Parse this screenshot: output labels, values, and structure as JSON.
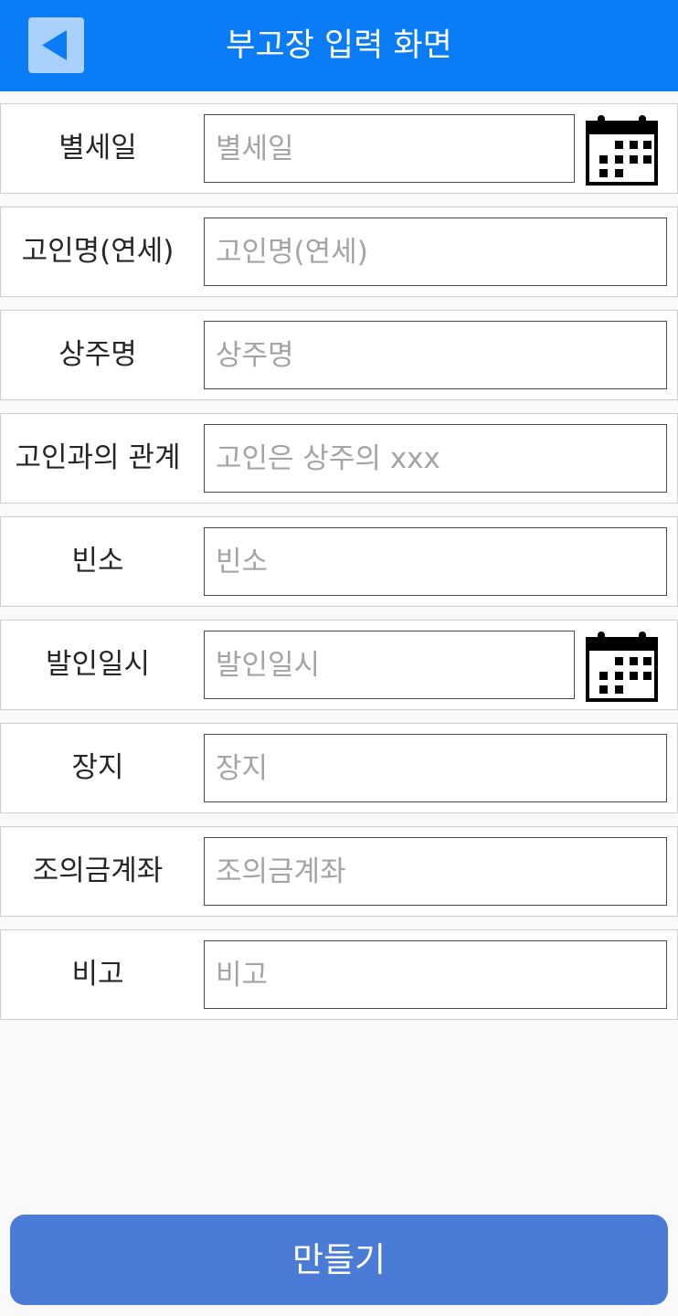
{
  "header": {
    "title": "부고장 입력 화면",
    "back_icon": "back-arrow-icon"
  },
  "colors": {
    "header_bg": "#0a7cf6",
    "back_btn_bg": "#a9d1fb",
    "back_icon": "#0a7cf6",
    "page_bg": "#f9f9f9",
    "submit_bg": "#4a7bd7"
  },
  "form": {
    "fields": [
      {
        "label": "별세일",
        "placeholder": "별세일",
        "value": "",
        "icon": "calendar-icon"
      },
      {
        "label": "고인명(연세)",
        "placeholder": "고인명(연세)",
        "value": ""
      },
      {
        "label": "상주명",
        "placeholder": "상주명",
        "value": ""
      },
      {
        "label": "고인과의 관계",
        "placeholder": "고인은 상주의 xxx",
        "value": ""
      },
      {
        "label": "빈소",
        "placeholder": "빈소",
        "value": ""
      },
      {
        "label": "발인일시",
        "placeholder": "발인일시",
        "value": "",
        "icon": "calendar-icon"
      },
      {
        "label": "장지",
        "placeholder": "장지",
        "value": ""
      },
      {
        "label": "조의금계좌",
        "placeholder": "조의금계좌",
        "value": ""
      },
      {
        "label": "비고",
        "placeholder": "비고",
        "value": ""
      }
    ]
  },
  "submit": {
    "label": "만들기"
  }
}
